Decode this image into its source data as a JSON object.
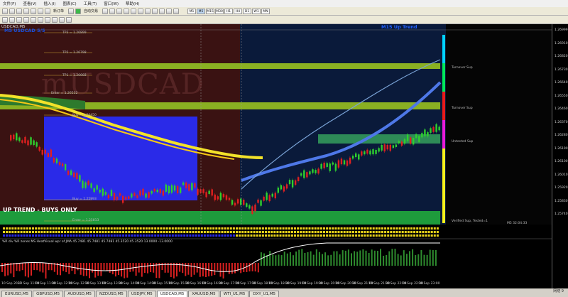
{
  "menu": [
    "文件(F)",
    "查看(V)",
    "插入(I)",
    "图表(C)",
    "工具(T)",
    "窗口(W)",
    "帮助(H)"
  ],
  "toolbar": {
    "new_order": "新订单",
    "auto_trade": "自动交易",
    "timeframes": [
      "M1",
      "M5",
      "M15",
      "M30",
      "H1",
      "H4",
      "D1",
      "W1",
      "MN"
    ],
    "active_timeframe": "M5"
  },
  "chart": {
    "title": "USDCAD,M5",
    "watermark": "mUSDCAD",
    "trend_label": "UP TREND - BUYS ONLY",
    "mtf_label": "M15 Up Trend",
    "blue_label": "M5 USDCAD 5/5",
    "zones": {
      "turnover_sup_1": "Turnover Sup",
      "turnover_sup_2": "Turnover Sup",
      "untested_sup": "Untested Sup",
      "verified_sup": "Verified Sup, Tested=1"
    },
    "countdown": "M5 32:04:33",
    "levels": {
      "tp3": "TP3 = 1.26899",
      "tp2": "TP2 = 1.26798",
      "tp1": "TP1 = 1.26668",
      "entry": "Enter = 1.26532",
      "buy_top": "Buy = 1.26450",
      "buy_low": "Buy = 1.25993",
      "enter_low": "Enter = 1.25813"
    },
    "price_ticks": [
      "1.26999",
      "1.26910",
      "1.26820",
      "1.26730",
      "1.26640",
      "1.26550",
      "1.26460",
      "1.26370",
      "1.26280",
      "1.26190",
      "1.26100",
      "1.26010",
      "1.25920",
      "1.25830",
      "1.25740"
    ],
    "time_ticks": [
      "10 Sep 2021",
      "10 Sep 11:00",
      "10 Sep 11:30",
      "10 Sep 12:00",
      "10 Sep 12:30",
      "10 Sep 13:00",
      "10 Sep 13:30",
      "10 Sep 14:00",
      "10 Sep 14:30",
      "10 Sep 15:00",
      "10 Sep 15:30",
      "10 Sep 16:00",
      "10 Sep 16:30",
      "10 Sep 17:00",
      "10 Sep 17:30",
      "10 Sep 18:00",
      "10 Sep 18:30",
      "10 Sep 19:00",
      "10 Sep 19:30",
      "10 Sep 20:00",
      "10 Sep 20:30",
      "10 Sep 21:00",
      "10 Sep 21:30",
      "10 Sep 22:00",
      "10 Sep 22:30",
      "10 Sep 23:00"
    ],
    "sub_indicator": "%R div %R zones MS HeatVisual wpr of JMA 45.7481 45.7481 45.7481 45.3520 45.3520 13.0000 -13.0000"
  },
  "tabs": [
    "EURUSD,M5",
    "GBPUSD,M5",
    "AUDUSD,M5",
    "NZDUSD,M5",
    "USDJPY,M5",
    "USDCAD,M5",
    "XAUUSD,M5",
    "WTI_U1,M5",
    "DXY_U1,M5"
  ],
  "active_tab": "USDCAD,M5",
  "status": "网络 9"
}
